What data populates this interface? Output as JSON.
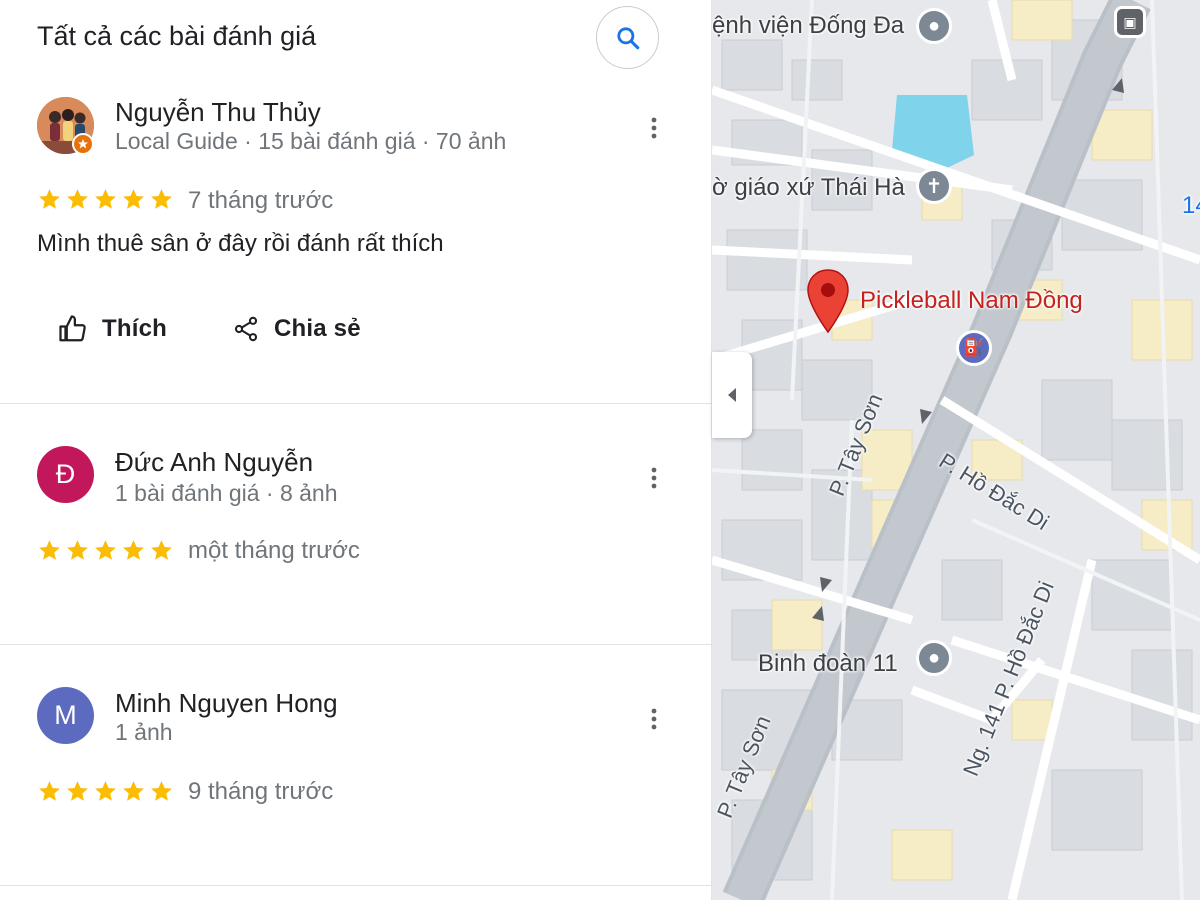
{
  "panel": {
    "title": "Tất cả các bài đánh giá",
    "search_icon": "search-icon"
  },
  "reviews": [
    {
      "name": "Nguyễn Thu Thủy",
      "meta": "Local Guide · 15 bài đánh giá · 70 ảnh",
      "avatar": "photo",
      "rating": 5,
      "time": "7 tháng trước",
      "text": "Mình thuê sân ở đây rồi đánh rất thích",
      "like_label": "Thích",
      "share_label": "Chia sẻ"
    },
    {
      "name": "Đức Anh Nguyễn",
      "meta": "1 bài đánh giá · 8 ảnh",
      "avatar_letter": "Đ",
      "avatar_color": "#c2185b",
      "rating": 5,
      "time": "một tháng trước"
    },
    {
      "name": "Minh Nguyen Hong",
      "meta": "1 ảnh",
      "avatar_letter": "M",
      "avatar_color": "#5c6bc0",
      "rating": 5,
      "time": "9 tháng trước"
    }
  ],
  "map": {
    "labels": {
      "hospital": "ệnh viện Đống Đa",
      "church": "ờ giáo xứ Thái Hà",
      "place": "Pickleball Nam Đồng",
      "street_tay_son_1": "P. Tây Sơn",
      "street_ho_dac_di": "P. Hồ Đắc Di",
      "military": "Binh đoàn 11",
      "street_ngo_141": "Ng. 141 P. Hồ Đắc Di",
      "street_tay_son_2": "P. Tây Sơn",
      "edge_number": "14"
    },
    "colors": {
      "place_pin": "#ea4335",
      "poi": "#7c8894",
      "gas": "#5c6bc0",
      "star": "#fbbc04",
      "accent": "#1a73e8"
    }
  }
}
